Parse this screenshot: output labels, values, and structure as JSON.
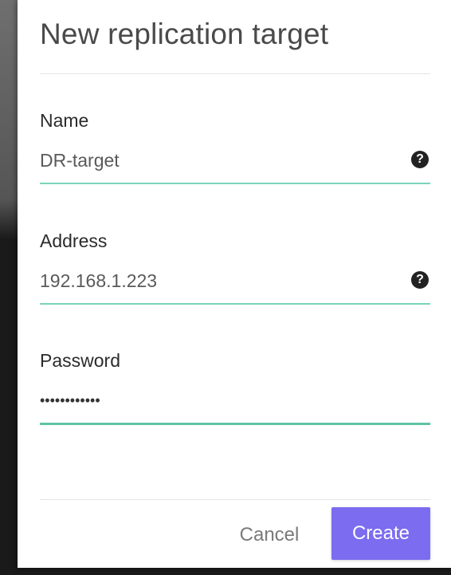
{
  "dialog": {
    "title": "New replication target"
  },
  "fields": {
    "name": {
      "label": "Name",
      "value": "DR-target",
      "help_icon": "?"
    },
    "address": {
      "label": "Address",
      "value": "192.168.1.223",
      "help_icon": "?"
    },
    "password": {
      "label": "Password",
      "masked_value": "••••••••••••"
    }
  },
  "actions": {
    "cancel_label": "Cancel",
    "create_label": "Create"
  },
  "colors": {
    "accent": "#7b6cf0",
    "field_underline": "#7ad3bb"
  }
}
